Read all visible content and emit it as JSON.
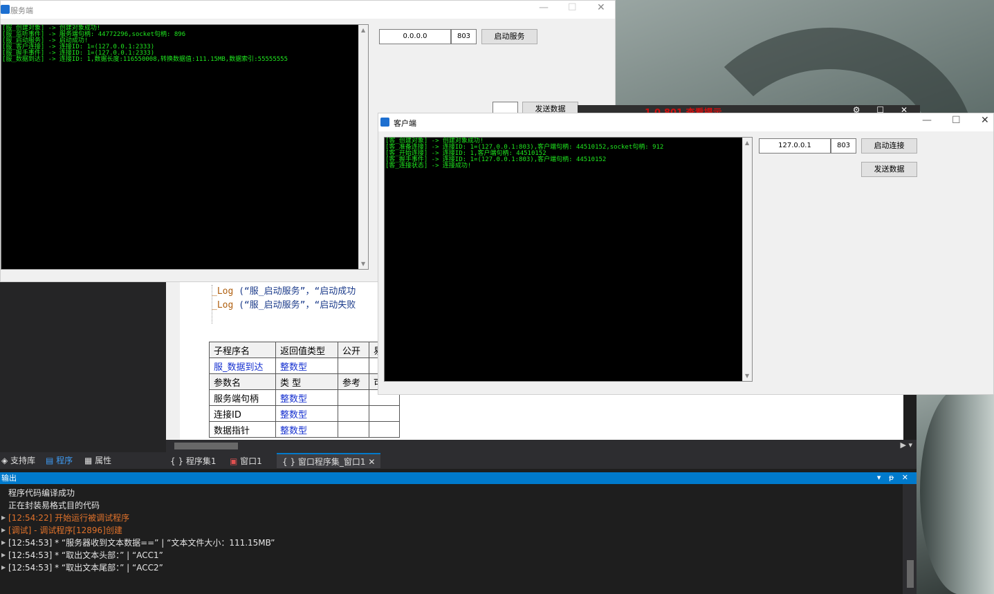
{
  "colors": {
    "console_bg": "#000000",
    "console_text": "#1fe81f",
    "accent": "#007acc",
    "output_warn": "#e0722b"
  },
  "bg_window": {
    "title_fragment": "1.0.801 查看提示"
  },
  "ide": {
    "code_lines": [
      {
        "fn": "_Log",
        "open": " (",
        "arg1": "“服_启动服务”",
        "sep": "，",
        "arg2": "“启动成功"
      },
      {
        "fn": "_Log",
        "open": " (",
        "arg1": "“服_启动服务”",
        "sep": "，",
        "arg2": "“启动失败"
      }
    ],
    "table": {
      "header1": [
        "子程序名",
        "返回值类型",
        "公开",
        "易包"
      ],
      "row1": [
        "服_数据到达",
        "整数型"
      ],
      "header2": [
        "参数名",
        "类 型",
        "参考",
        "可空"
      ],
      "params": [
        [
          "服务端句柄",
          "整数型"
        ],
        [
          "连接ID",
          "整数型"
        ],
        [
          "数据指针",
          "整数型"
        ]
      ]
    },
    "left_tabs": [
      {
        "icon": "support-lib-icon",
        "label": "支持库"
      },
      {
        "icon": "program-icon",
        "label": "程序"
      },
      {
        "icon": "property-icon",
        "label": "属性"
      }
    ],
    "file_tabs": [
      {
        "label": "{ } 程序集1"
      },
      {
        "label": "窗口1"
      },
      {
        "label": "{ } 窗口程序集_窗口1",
        "close": "✕"
      }
    ],
    "output": {
      "header": "输出",
      "controls": "▾ ᵽ ✕",
      "lines": [
        {
          "text": "程序代码编译成功",
          "style": "wht",
          "arrow": false
        },
        {
          "text": "正在封装易格式目的代码",
          "style": "wht",
          "arrow": false
        },
        {
          "text": "[12:54:22] 开始运行被调试程序",
          "style": "org",
          "arrow": true
        },
        {
          "text": "[调试] - 调试程序[12896]创建",
          "style": "org",
          "arrow": true
        },
        {
          "text": "[12:54:53] * “服务器收到文本数据==” | “文本文件大小：111.15MB”",
          "style": "wht",
          "arrow": true
        },
        {
          "text": "[12:54:53] * “取出文本头部：” | “ACC1”",
          "style": "wht",
          "arrow": true
        },
        {
          "text": "[12:54:53] * “取出文本尾部：” | “ACC2”",
          "style": "wht",
          "arrow": true
        }
      ]
    }
  },
  "server": {
    "title": "服务端",
    "log": [
      "[服_创建对象] -> 创建对象成功!",
      "[服_监听事件] -> 服务端句柄: 44772296,socket句柄: 896",
      "[服_启动服务] -> 启动成功!",
      "[服_客户连接] -> 连接ID: 1=(127.0.0.1:2333)",
      "[服_握手事件] -> 连接ID: 1=(127.0.0.1:2333)",
      "[服_数据到达] -> 连接ID: 1,数据长度:116550008,转换数据值:111.15MB,数据索引:55555555"
    ],
    "ip": "0.0.0.0",
    "port": "803",
    "start_button": "启动服务",
    "send_input": "",
    "send_button": "发送数据"
  },
  "client": {
    "title": "客户端",
    "log": [
      "[客_创建对象] -> 创建对象成功!",
      "[客_准备连接] -> 连接ID: 1=(127.0.0.1:803),客户端句柄: 44510152,socket句柄: 912",
      "[客_开始连接] -> 连接ID: 1,客户端句柄: 44510152",
      "[客_握手事件] -> 连接ID: 1=(127.0.0.1:803),客户端句柄: 44510152",
      "[客_连接状态] -> 连接成功!"
    ],
    "ip": "127.0.0.1",
    "port": "803",
    "connect_button": "启动连接",
    "send_button": "发送数据"
  },
  "window_controls": {
    "min": "—",
    "max": "☐",
    "close": "✕"
  }
}
